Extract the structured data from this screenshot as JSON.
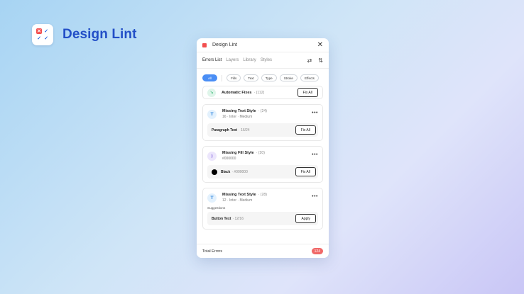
{
  "brand": {
    "title": "Design Lint",
    "logo_icon": "lint-logo-icon"
  },
  "panel": {
    "title": "Design Lint",
    "tabs": [
      {
        "label": "Errors List",
        "active": true
      },
      {
        "label": "Layers",
        "active": false
      },
      {
        "label": "Library",
        "active": false
      },
      {
        "label": "Styles",
        "active": false
      }
    ],
    "toolbar_icons": [
      "refresh-icon",
      "sort-icon"
    ],
    "filters": [
      "All",
      "Fills",
      "Text",
      "Type",
      "Stroke",
      "Effects"
    ],
    "automatic_fixes": {
      "label": "Automatic Fixes",
      "count": "· (112)",
      "button": "Fix All"
    },
    "errors": [
      {
        "icon": "text-icon",
        "icon_glyph": "T",
        "title": "Missing Text Style",
        "count": "· (24)",
        "subtitle": "16 · Inter · Medium",
        "fix": {
          "label": "Paragraph Text",
          "meta": "· 16/24",
          "button": "Fix All"
        }
      },
      {
        "icon": "fill-icon",
        "icon_glyph": "◊",
        "title": "Missing Fill Style",
        "count": "· (20)",
        "subtitle": "#000000",
        "fix": {
          "label": "Black",
          "meta": "· #000000",
          "button": "Fix All",
          "swatch": "#000000"
        }
      },
      {
        "icon": "text-icon",
        "icon_glyph": "T",
        "title": "Missing Text Style",
        "count": "· (28)",
        "subtitle": "12 · Inter · Medium",
        "suggestions_label": "Suggestions",
        "fix": {
          "label": "Button Text",
          "meta": "· 12/16",
          "button": "Apply"
        }
      }
    ],
    "footer": {
      "label": "Total Errors",
      "total": "124"
    }
  },
  "colors": {
    "accent": "#4a8ef5",
    "brand": "#234fc7",
    "error_badge": "#f06868"
  }
}
